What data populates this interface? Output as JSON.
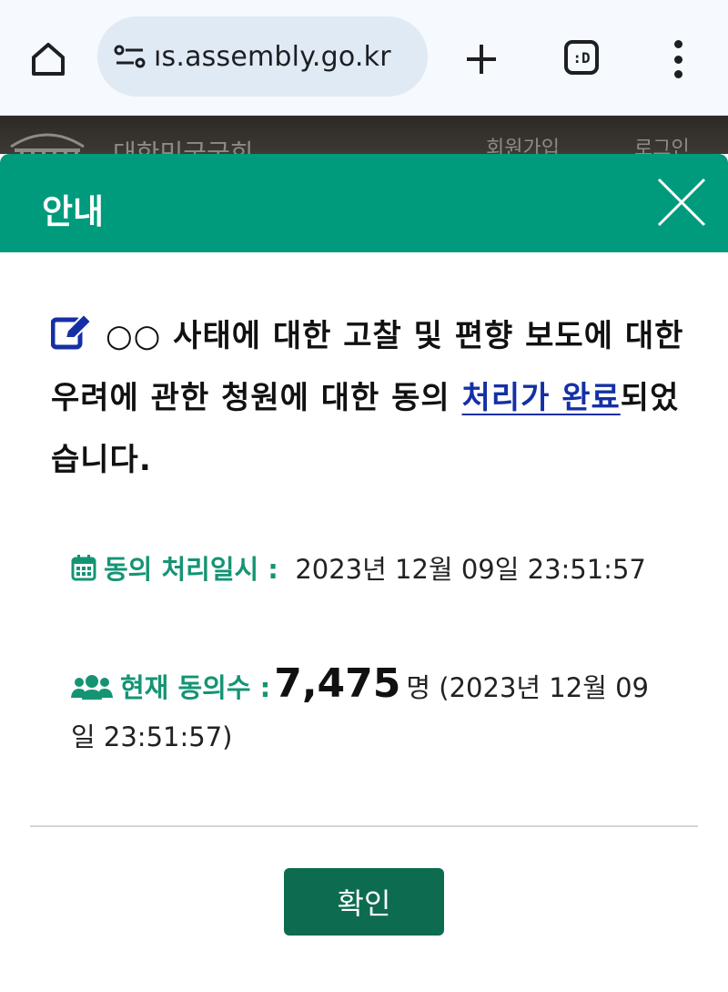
{
  "browser": {
    "url": "ıs.assembly.go.kr",
    "tab_count_label": ":D"
  },
  "site_header": {
    "title": "대한민국국회",
    "join_label": "회원가입",
    "login_label": "로그인"
  },
  "modal": {
    "title": "안내",
    "message_before_link": "○○ 사태에 대한 고찰 및 편향 보도에 대한 우려에 관한 청원에 대한 동의 ",
    "message_link": "처리가 완료",
    "message_after_link": "되었습니다.",
    "date_label": "동의 처리일시 :",
    "date_value": "2023년 12월 09일 23:51:57",
    "count_label": "현재 동의수 :",
    "count_value": "7,475",
    "count_unit": "명",
    "count_timestamp": "(2023년 12월 09일 23:51:57)",
    "confirm_label": "확인"
  },
  "colors": {
    "accent_green": "#009b7c",
    "label_green": "#159474",
    "button_green": "#0d6b50",
    "link_blue": "#1530a6"
  },
  "icons": [
    "home-icon",
    "site-info-icon",
    "plus-icon",
    "tabs-icon",
    "more-menu-icon",
    "close-icon",
    "edit-icon",
    "calendar-icon",
    "users-icon"
  ]
}
